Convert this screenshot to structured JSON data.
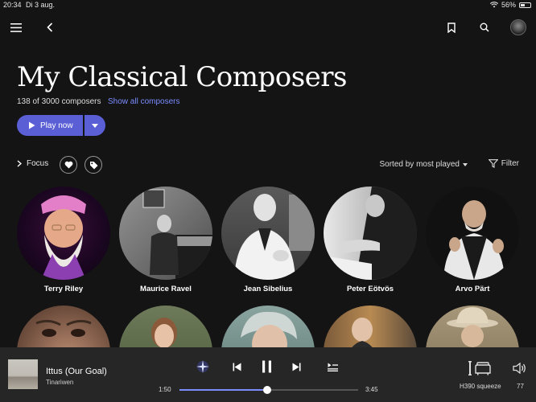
{
  "status": {
    "time": "20:34",
    "date": "Di 3 aug.",
    "battery": "56%",
    "battery_level": 0.56
  },
  "header": {
    "title": "My Classical Composers",
    "count": "138 of 3000 composers",
    "show_all": "Show all composers"
  },
  "play": {
    "label": "Play now"
  },
  "filters": {
    "focus": "Focus",
    "sort": "Sorted by most played",
    "filter": "Filter"
  },
  "composers": [
    {
      "name": "Terry Riley"
    },
    {
      "name": "Maurice Ravel"
    },
    {
      "name": "Jean Sibelius"
    },
    {
      "name": "Peter Eötvös"
    },
    {
      "name": "Arvo Pärt"
    }
  ],
  "player": {
    "track": "Ittus (Our Goal)",
    "artist": "Tinariwen",
    "elapsed": "1:50",
    "duration": "3:45",
    "progress": 0.489,
    "device": "H390 squeeze",
    "volume": "77"
  },
  "colors": {
    "accent": "#5b5fd6",
    "link": "#7a8cff",
    "background": "#141414",
    "player_bg": "#262626"
  }
}
